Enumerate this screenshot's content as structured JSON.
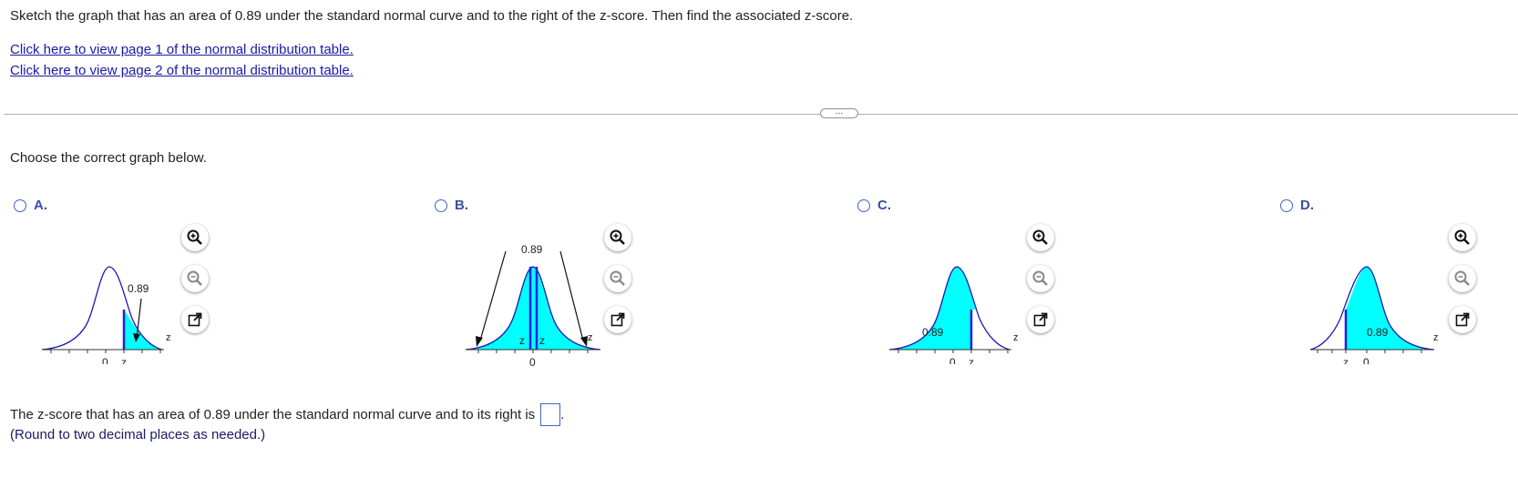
{
  "question": {
    "text": "Sketch the graph that has an area of 0.89 under the standard normal curve and to the right of the z-score. Then find the associated z-score.",
    "link_page1": "Click here to view page 1 of the normal distribution table.",
    "link_page2": "Click here to view page 2 of the normal distribution table."
  },
  "expander_label": "...",
  "choose_prompt": "Choose the correct graph below.",
  "options": [
    {
      "letter": "A.",
      "area_label": "0.89",
      "axis_labels": [
        "0",
        "z"
      ],
      "var_label": "z"
    },
    {
      "letter": "B.",
      "area_label": "0.89",
      "axis_labels": [
        "0"
      ],
      "inner_labels": [
        "z",
        "z"
      ],
      "var_label": "z"
    },
    {
      "letter": "C.",
      "area_label": "0.89",
      "axis_labels": [
        "0",
        "z"
      ],
      "var_label": "z"
    },
    {
      "letter": "D.",
      "area_label": "0.89",
      "axis_labels": [
        "z",
        "0"
      ],
      "var_label": "z"
    }
  ],
  "answer": {
    "prompt": "The z-score that has an area of 0.89 under the standard normal curve and to its right is",
    "value": "",
    "suffix": ".",
    "note": "(Round to two decimal places as needed.)"
  },
  "colors": {
    "fill": "#00ffff",
    "curve": "#1a1ab0",
    "boundary": "#2020e0",
    "link": "#1a1aa6",
    "radio": "#3a63c7"
  },
  "icons": [
    "zoom-in-icon",
    "zoom-out-icon",
    "external-link-icon"
  ]
}
